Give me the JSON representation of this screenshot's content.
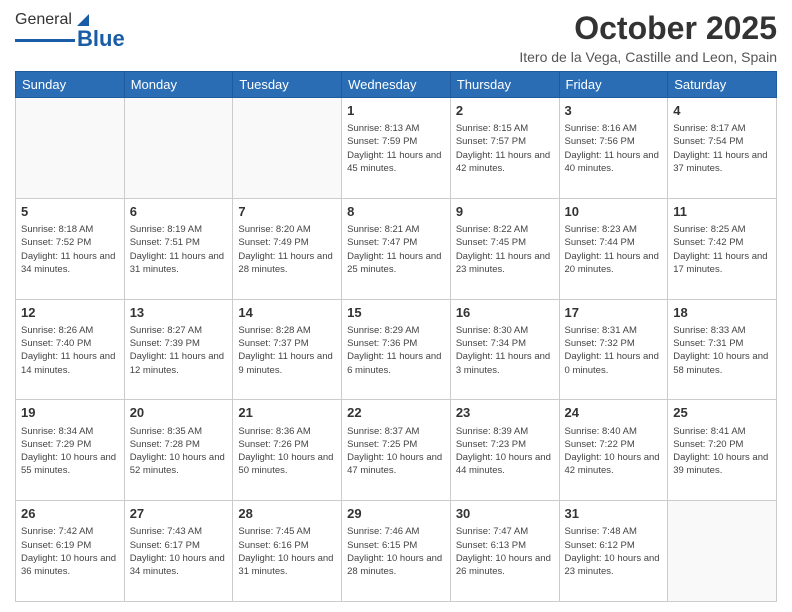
{
  "logo": {
    "general": "General",
    "blue": "Blue"
  },
  "header": {
    "month": "October 2025",
    "location": "Itero de la Vega, Castille and Leon, Spain"
  },
  "days_of_week": [
    "Sunday",
    "Monday",
    "Tuesday",
    "Wednesday",
    "Thursday",
    "Friday",
    "Saturday"
  ],
  "weeks": [
    [
      {
        "num": "",
        "info": ""
      },
      {
        "num": "",
        "info": ""
      },
      {
        "num": "",
        "info": ""
      },
      {
        "num": "1",
        "info": "Sunrise: 8:13 AM\nSunset: 7:59 PM\nDaylight: 11 hours and 45 minutes."
      },
      {
        "num": "2",
        "info": "Sunrise: 8:15 AM\nSunset: 7:57 PM\nDaylight: 11 hours and 42 minutes."
      },
      {
        "num": "3",
        "info": "Sunrise: 8:16 AM\nSunset: 7:56 PM\nDaylight: 11 hours and 40 minutes."
      },
      {
        "num": "4",
        "info": "Sunrise: 8:17 AM\nSunset: 7:54 PM\nDaylight: 11 hours and 37 minutes."
      }
    ],
    [
      {
        "num": "5",
        "info": "Sunrise: 8:18 AM\nSunset: 7:52 PM\nDaylight: 11 hours and 34 minutes."
      },
      {
        "num": "6",
        "info": "Sunrise: 8:19 AM\nSunset: 7:51 PM\nDaylight: 11 hours and 31 minutes."
      },
      {
        "num": "7",
        "info": "Sunrise: 8:20 AM\nSunset: 7:49 PM\nDaylight: 11 hours and 28 minutes."
      },
      {
        "num": "8",
        "info": "Sunrise: 8:21 AM\nSunset: 7:47 PM\nDaylight: 11 hours and 25 minutes."
      },
      {
        "num": "9",
        "info": "Sunrise: 8:22 AM\nSunset: 7:45 PM\nDaylight: 11 hours and 23 minutes."
      },
      {
        "num": "10",
        "info": "Sunrise: 8:23 AM\nSunset: 7:44 PM\nDaylight: 11 hours and 20 minutes."
      },
      {
        "num": "11",
        "info": "Sunrise: 8:25 AM\nSunset: 7:42 PM\nDaylight: 11 hours and 17 minutes."
      }
    ],
    [
      {
        "num": "12",
        "info": "Sunrise: 8:26 AM\nSunset: 7:40 PM\nDaylight: 11 hours and 14 minutes."
      },
      {
        "num": "13",
        "info": "Sunrise: 8:27 AM\nSunset: 7:39 PM\nDaylight: 11 hours and 12 minutes."
      },
      {
        "num": "14",
        "info": "Sunrise: 8:28 AM\nSunset: 7:37 PM\nDaylight: 11 hours and 9 minutes."
      },
      {
        "num": "15",
        "info": "Sunrise: 8:29 AM\nSunset: 7:36 PM\nDaylight: 11 hours and 6 minutes."
      },
      {
        "num": "16",
        "info": "Sunrise: 8:30 AM\nSunset: 7:34 PM\nDaylight: 11 hours and 3 minutes."
      },
      {
        "num": "17",
        "info": "Sunrise: 8:31 AM\nSunset: 7:32 PM\nDaylight: 11 hours and 0 minutes."
      },
      {
        "num": "18",
        "info": "Sunrise: 8:33 AM\nSunset: 7:31 PM\nDaylight: 10 hours and 58 minutes."
      }
    ],
    [
      {
        "num": "19",
        "info": "Sunrise: 8:34 AM\nSunset: 7:29 PM\nDaylight: 10 hours and 55 minutes."
      },
      {
        "num": "20",
        "info": "Sunrise: 8:35 AM\nSunset: 7:28 PM\nDaylight: 10 hours and 52 minutes."
      },
      {
        "num": "21",
        "info": "Sunrise: 8:36 AM\nSunset: 7:26 PM\nDaylight: 10 hours and 50 minutes."
      },
      {
        "num": "22",
        "info": "Sunrise: 8:37 AM\nSunset: 7:25 PM\nDaylight: 10 hours and 47 minutes."
      },
      {
        "num": "23",
        "info": "Sunrise: 8:39 AM\nSunset: 7:23 PM\nDaylight: 10 hours and 44 minutes."
      },
      {
        "num": "24",
        "info": "Sunrise: 8:40 AM\nSunset: 7:22 PM\nDaylight: 10 hours and 42 minutes."
      },
      {
        "num": "25",
        "info": "Sunrise: 8:41 AM\nSunset: 7:20 PM\nDaylight: 10 hours and 39 minutes."
      }
    ],
    [
      {
        "num": "26",
        "info": "Sunrise: 7:42 AM\nSunset: 6:19 PM\nDaylight: 10 hours and 36 minutes."
      },
      {
        "num": "27",
        "info": "Sunrise: 7:43 AM\nSunset: 6:17 PM\nDaylight: 10 hours and 34 minutes."
      },
      {
        "num": "28",
        "info": "Sunrise: 7:45 AM\nSunset: 6:16 PM\nDaylight: 10 hours and 31 minutes."
      },
      {
        "num": "29",
        "info": "Sunrise: 7:46 AM\nSunset: 6:15 PM\nDaylight: 10 hours and 28 minutes."
      },
      {
        "num": "30",
        "info": "Sunrise: 7:47 AM\nSunset: 6:13 PM\nDaylight: 10 hours and 26 minutes."
      },
      {
        "num": "31",
        "info": "Sunrise: 7:48 AM\nSunset: 6:12 PM\nDaylight: 10 hours and 23 minutes."
      },
      {
        "num": "",
        "info": ""
      }
    ]
  ]
}
